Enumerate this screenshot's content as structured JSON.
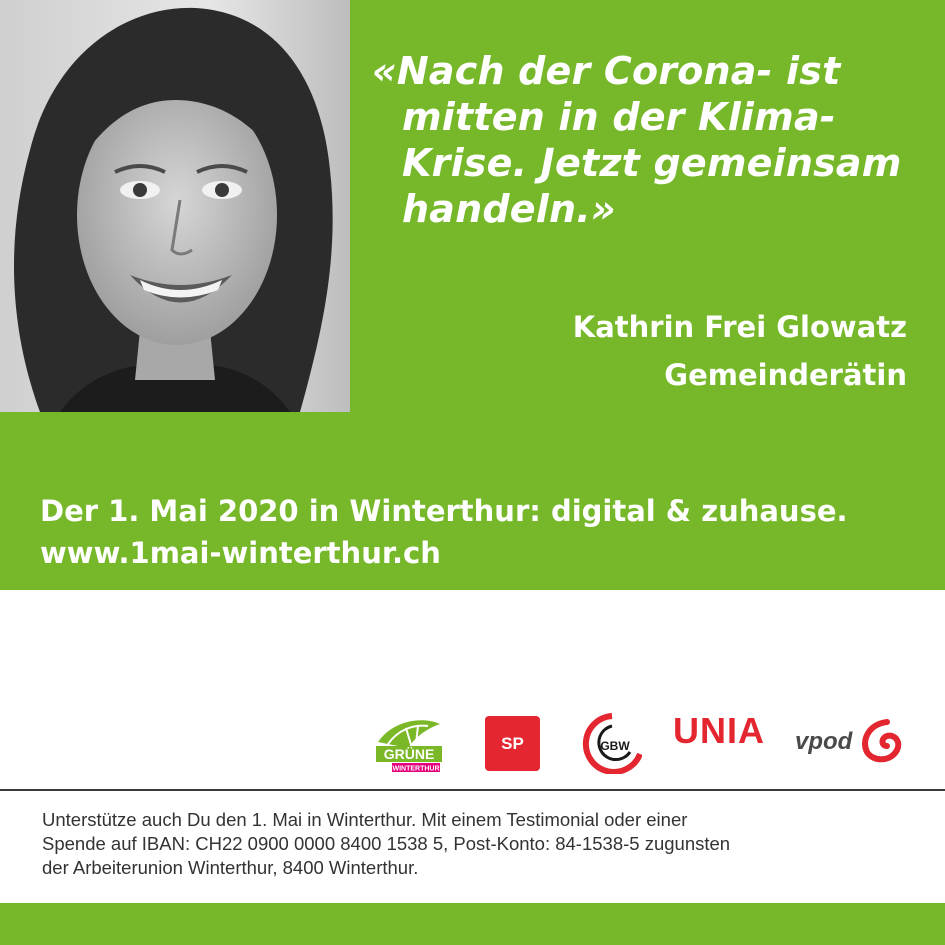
{
  "quote": {
    "lines": [
      "«Nach der Corona- ist",
      "mitten in der Klima-",
      "Krise. Jetzt gemeinsam",
      "handeln.»"
    ]
  },
  "author": {
    "name": "Kathrin Frei Glowatz",
    "role": "Gemeinderätin"
  },
  "event": {
    "line": "Der 1. Mai 2020 in Winterthur: digital & zuhause.",
    "url": "www.1mai-winterthur.ch"
  },
  "logos": {
    "gruene": {
      "name": "GRÜNE",
      "sub": "WINTERTHUR"
    },
    "sp": "SP",
    "gbw": "GBW",
    "unia": "UNIA",
    "vpod": "vpod"
  },
  "support": {
    "lines": [
      "Unterstütze auch Du den 1. Mai in Winterthur. Mit einem Testimonial oder einer",
      "Spende auf IBAN: CH22 0900 0000 8400 1538 5, Post-Konto: 84-1538-5 zugunsten",
      "der Arbeiterunion Winterthur, 8400 Winterthur."
    ]
  },
  "colors": {
    "green": "#77b82a",
    "red": "#e3262f",
    "text_dark": "#333333"
  }
}
